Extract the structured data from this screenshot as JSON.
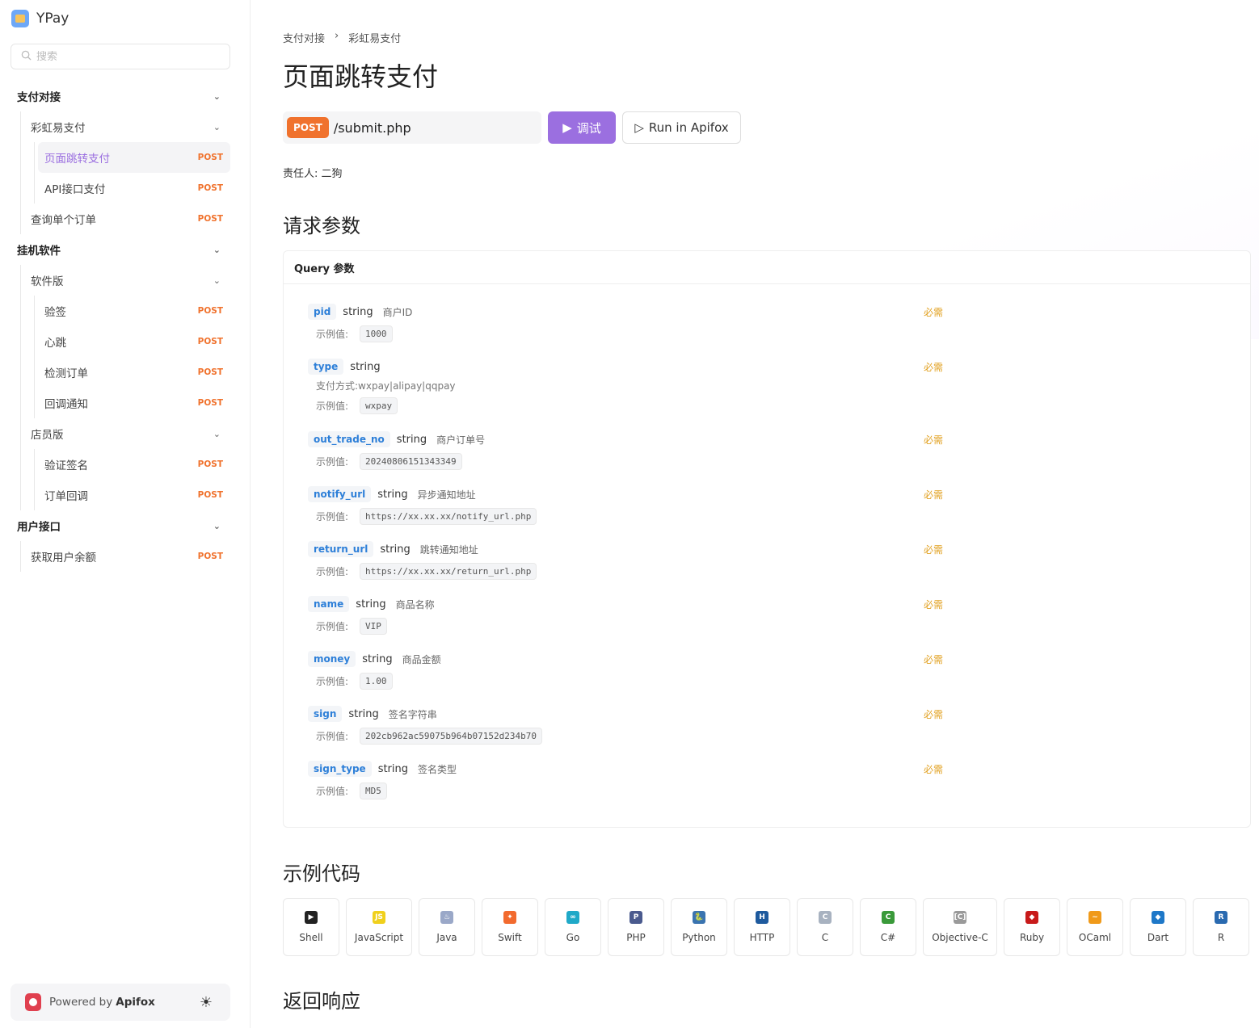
{
  "brand": {
    "name": "YPay"
  },
  "search": {
    "placeholder": "搜索"
  },
  "nav": [
    {
      "label": "支付对接",
      "kind": "group",
      "level": 0
    },
    {
      "label": "彩虹易支付",
      "kind": "folder",
      "level": 1
    },
    {
      "label": "页面跳转支付",
      "kind": "api",
      "level": 2,
      "method": "POST",
      "active": true
    },
    {
      "label": "API接口支付",
      "kind": "api",
      "level": 2,
      "method": "POST"
    },
    {
      "label": "查询单个订单",
      "kind": "api",
      "level": 1,
      "method": "POST"
    },
    {
      "label": "挂机软件",
      "kind": "group",
      "level": 0
    },
    {
      "label": "软件版",
      "kind": "folder",
      "level": 1
    },
    {
      "label": "验签",
      "kind": "api",
      "level": 2,
      "method": "POST"
    },
    {
      "label": "心跳",
      "kind": "api",
      "level": 2,
      "method": "POST"
    },
    {
      "label": "检测订单",
      "kind": "api",
      "level": 2,
      "method": "POST"
    },
    {
      "label": "回调通知",
      "kind": "api",
      "level": 2,
      "method": "POST"
    },
    {
      "label": "店员版",
      "kind": "folder",
      "level": 1
    },
    {
      "label": "验证签名",
      "kind": "api",
      "level": 2,
      "method": "POST"
    },
    {
      "label": "订单回调",
      "kind": "api",
      "level": 2,
      "method": "POST"
    },
    {
      "label": "用户接口",
      "kind": "group",
      "level": 0
    },
    {
      "label": "获取用户余额",
      "kind": "api",
      "level": 1,
      "method": "POST"
    }
  ],
  "powered": {
    "prefix": "Powered by",
    "name": "Apifox"
  },
  "breadcrumb": {
    "first": "支付对接",
    "sep": "›",
    "second": "彩虹易支付"
  },
  "page": {
    "title": "页面跳转支付",
    "method": "POST",
    "path": "/submit.php",
    "debug_label": "调试",
    "run_label": "Run in Apifox",
    "owner": "责任人:  二狗"
  },
  "sections": {
    "request": "请求参数",
    "query_header": "Query 参数",
    "examples": "示例代码",
    "response": "返回响应"
  },
  "example_label": "示例值:",
  "required_label": "必需",
  "params": [
    {
      "name": "pid",
      "type": "string",
      "desc": "商户ID",
      "note": "",
      "example": "1000"
    },
    {
      "name": "type",
      "type": "string",
      "desc": "",
      "note": "支付方式:wxpay|alipay|qqpay",
      "example": "wxpay"
    },
    {
      "name": "out_trade_no",
      "type": "string",
      "desc": "商户订单号",
      "note": "",
      "example": "20240806151343349"
    },
    {
      "name": "notify_url",
      "type": "string",
      "desc": "异步通知地址",
      "note": "",
      "example": "https://xx.xx.xx/notify_url.php"
    },
    {
      "name": "return_url",
      "type": "string",
      "desc": "跳转通知地址",
      "note": "",
      "example": "https://xx.xx.xx/return_url.php"
    },
    {
      "name": "name",
      "type": "string",
      "desc": "商品名称",
      "note": "",
      "example": "VIP"
    },
    {
      "name": "money",
      "type": "string",
      "desc": "商品金额",
      "note": "",
      "example": "1.00"
    },
    {
      "name": "sign",
      "type": "string",
      "desc": "签名字符串",
      "note": "",
      "example": "202cb962ac59075b964b07152d234b70"
    },
    {
      "name": "sign_type",
      "type": "string",
      "desc": "签名类型",
      "note": "",
      "example": "MD5"
    }
  ],
  "languages": [
    {
      "label": "Shell",
      "icon": "shell-icon",
      "color": "#222222",
      "glyph": "▶"
    },
    {
      "label": "JavaScript",
      "icon": "javascript-icon",
      "color": "#f0d01c",
      "glyph": "JS"
    },
    {
      "label": "Java",
      "icon": "java-icon",
      "color": "#9aa8c8",
      "glyph": "♨"
    },
    {
      "label": "Swift",
      "icon": "swift-icon",
      "color": "#f26a2e",
      "glyph": "✦"
    },
    {
      "label": "Go",
      "icon": "go-icon",
      "color": "#20a9c8",
      "glyph": "∞"
    },
    {
      "label": "PHP",
      "icon": "php-icon",
      "color": "#4a5a8e",
      "glyph": "P"
    },
    {
      "label": "Python",
      "icon": "python-icon",
      "color": "#3a74b0",
      "glyph": "🐍"
    },
    {
      "label": "HTTP",
      "icon": "http-icon",
      "color": "#1e5a9e",
      "glyph": "H"
    },
    {
      "label": "C",
      "icon": "c-icon",
      "color": "#a8b2c0",
      "glyph": "C"
    },
    {
      "label": "C#",
      "icon": "csharp-icon",
      "color": "#3a9a3a",
      "glyph": "C"
    },
    {
      "label": "Objective-C",
      "icon": "objective-c-icon",
      "color": "#9a9a9a",
      "glyph": "[C]"
    },
    {
      "label": "Ruby",
      "icon": "ruby-icon",
      "color": "#c81a1a",
      "glyph": "◆"
    },
    {
      "label": "OCaml",
      "icon": "ocaml-icon",
      "color": "#f09a1a",
      "glyph": "~"
    },
    {
      "label": "Dart",
      "icon": "dart-icon",
      "color": "#1e78c8",
      "glyph": "◆"
    },
    {
      "label": "R",
      "icon": "r-icon",
      "color": "#2a6ab0",
      "glyph": "R"
    }
  ]
}
